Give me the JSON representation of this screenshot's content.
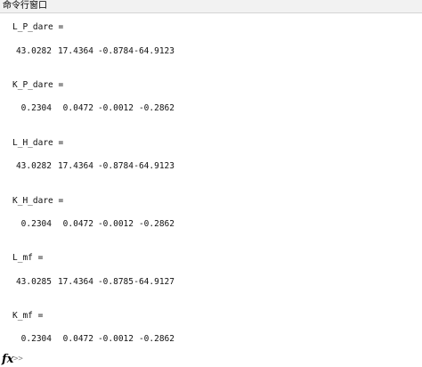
{
  "window": {
    "title": "命令行窗口"
  },
  "output": [
    {
      "name": "L_P_dare =",
      "values": [
        "43.0282",
        "17.4364",
        "-0.8784",
        "-64.9123"
      ]
    },
    {
      "name": "K_P_dare =",
      "values": [
        "0.2304",
        "0.0472",
        "-0.0012",
        "-0.2862"
      ]
    },
    {
      "name": "L_H_dare =",
      "values": [
        "43.0282",
        "17.4364",
        "-0.8784",
        "-64.9123"
      ]
    },
    {
      "name": "K_H_dare =",
      "values": [
        "0.2304",
        "0.0472",
        "-0.0012",
        "-0.2862"
      ]
    },
    {
      "name": "L_mf =",
      "values": [
        "43.0285",
        "17.4364",
        "-0.8785",
        "-64.9127"
      ]
    },
    {
      "name": "K_mf =",
      "values": [
        "0.2304",
        "0.0472",
        "-0.0012",
        "-0.2862"
      ]
    }
  ],
  "prompt": {
    "fx_label": "fx",
    "symbol": ">>"
  }
}
